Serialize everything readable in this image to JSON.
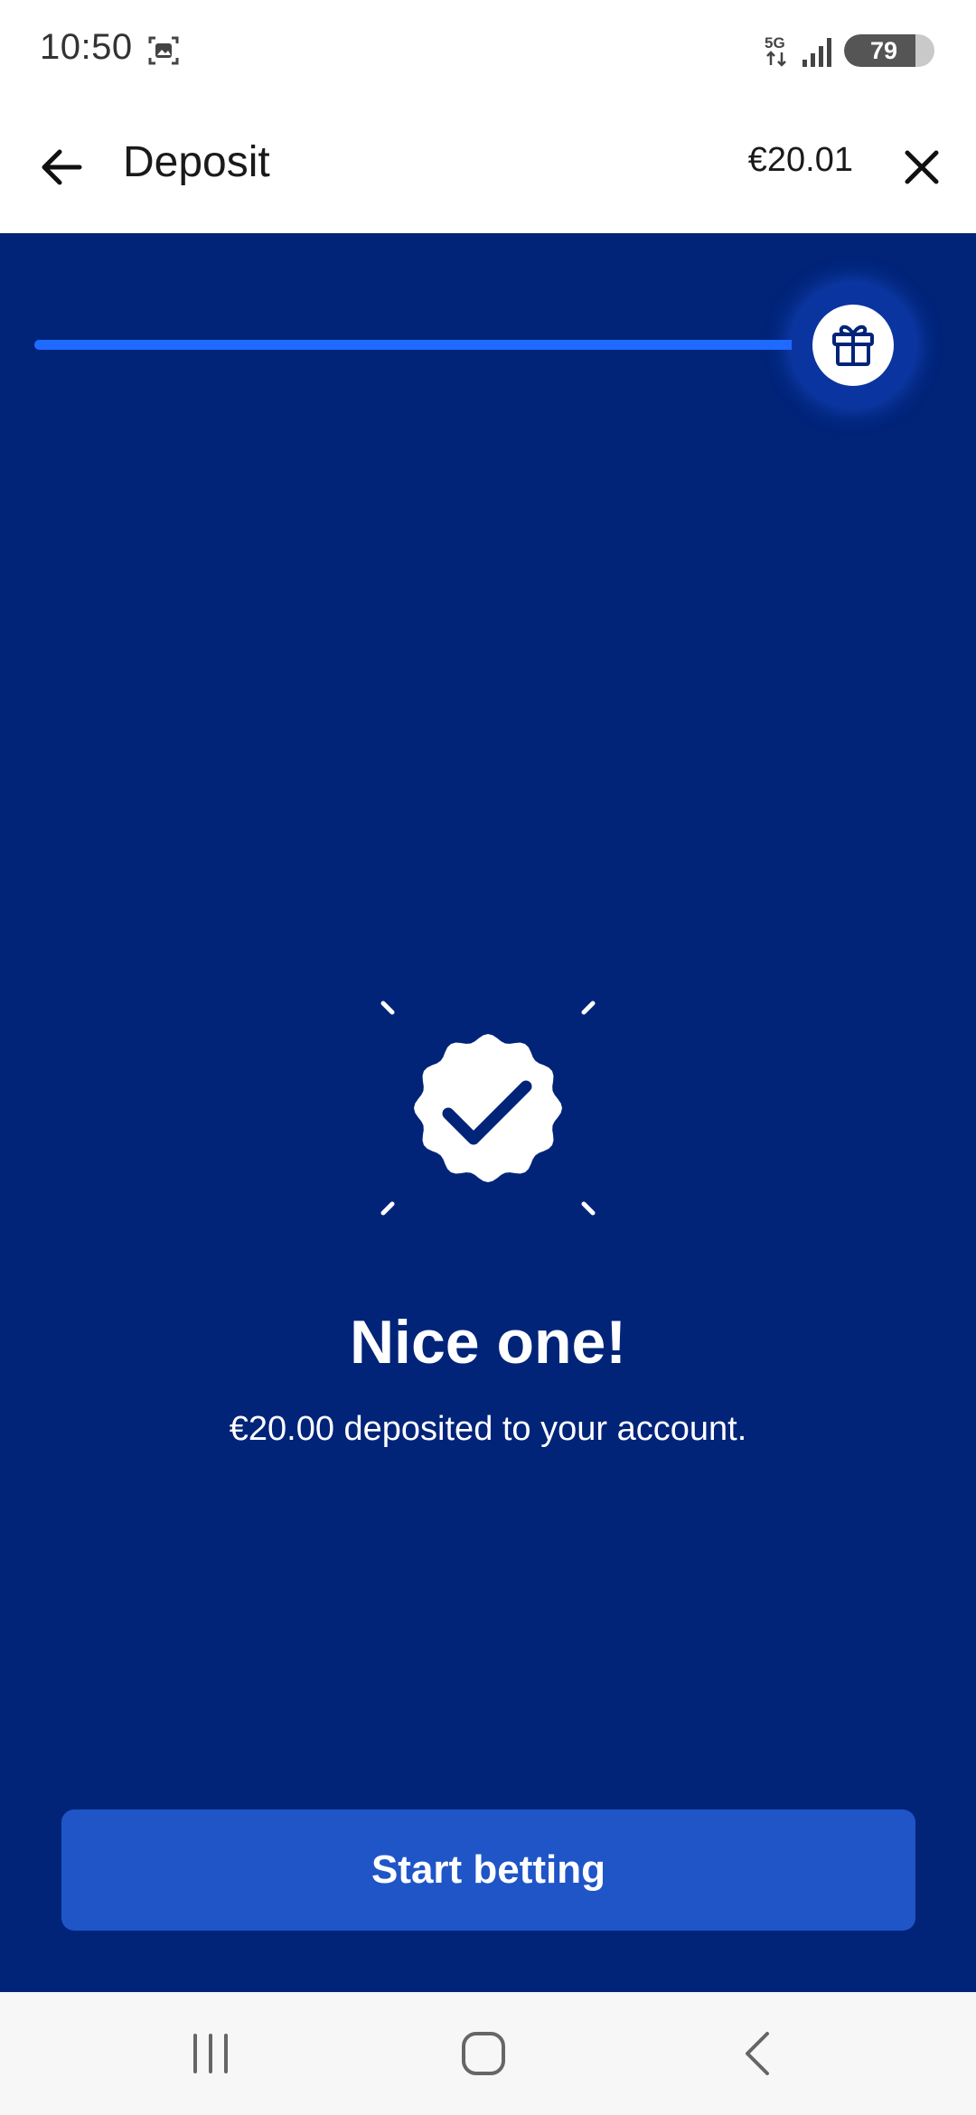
{
  "status_bar": {
    "time": "10:50",
    "network": "5G",
    "battery_level": "79",
    "icons": [
      "screenshot-icon",
      "network-5g-icon",
      "signal-icon",
      "battery-icon"
    ]
  },
  "header": {
    "title": "Deposit",
    "balance": "€20.01",
    "back_icon": "arrow-left-icon",
    "close_icon": "close-icon"
  },
  "progress": {
    "fraction": 1.0,
    "end_icon": "gift-icon"
  },
  "success": {
    "icon": "check-badge-icon",
    "title": "Nice one!",
    "message": "€20.00 deposited to your account."
  },
  "cta": {
    "label": "Start betting"
  },
  "nav_bar": {
    "icons": [
      "recents-icon",
      "home-icon",
      "back-icon"
    ]
  },
  "colors": {
    "primary_background": "#012479",
    "progress_fill": "#1f6bff",
    "button": "#1f55c7",
    "text_on_dark": "#ffffff"
  }
}
